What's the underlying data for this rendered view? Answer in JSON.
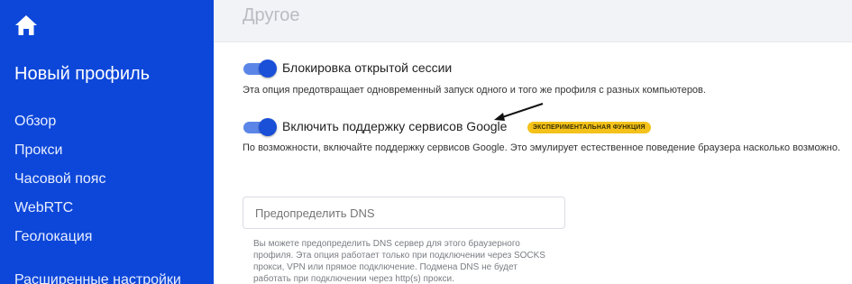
{
  "sidebar": {
    "home_icon": "home-icon",
    "profile_title": "Новый профиль",
    "items": [
      {
        "label": "Обзор"
      },
      {
        "label": "Прокси"
      },
      {
        "label": "Часовой пояс"
      },
      {
        "label": "WebRTC"
      },
      {
        "label": "Геолокация"
      },
      {
        "label": "Расширенные настройки"
      }
    ],
    "background_color": "#0d47d9"
  },
  "main": {
    "section_title": "Другое",
    "options": [
      {
        "label": "Блокировка открытой сессии",
        "enabled": true,
        "description": "Эта опция предотвращает одновременный запуск одного и того же профиля с разных компьютеров."
      },
      {
        "label": "Включить поддержку сервисов Google",
        "enabled": true,
        "badge": "ЭКСПЕРИМЕНТАЛЬНАЯ ФУНКЦИЯ",
        "description": "По возможности, включайте поддержку сервисов Google. Это эмулирует естественное поведение браузера насколько возможно."
      }
    ],
    "dns": {
      "placeholder": "Предопределить DNS",
      "value": "",
      "hint": "Вы можете предопределить DNS сервер для этого браузерного профиля. Эта опция работает только при подключении через SOCKS прокси, VPN или прямое подключение. Подмена DNS не будет работать при подключении через http(s) прокси."
    },
    "accent_color": "#1a4fd8",
    "badge_color": "#f4c21a"
  }
}
